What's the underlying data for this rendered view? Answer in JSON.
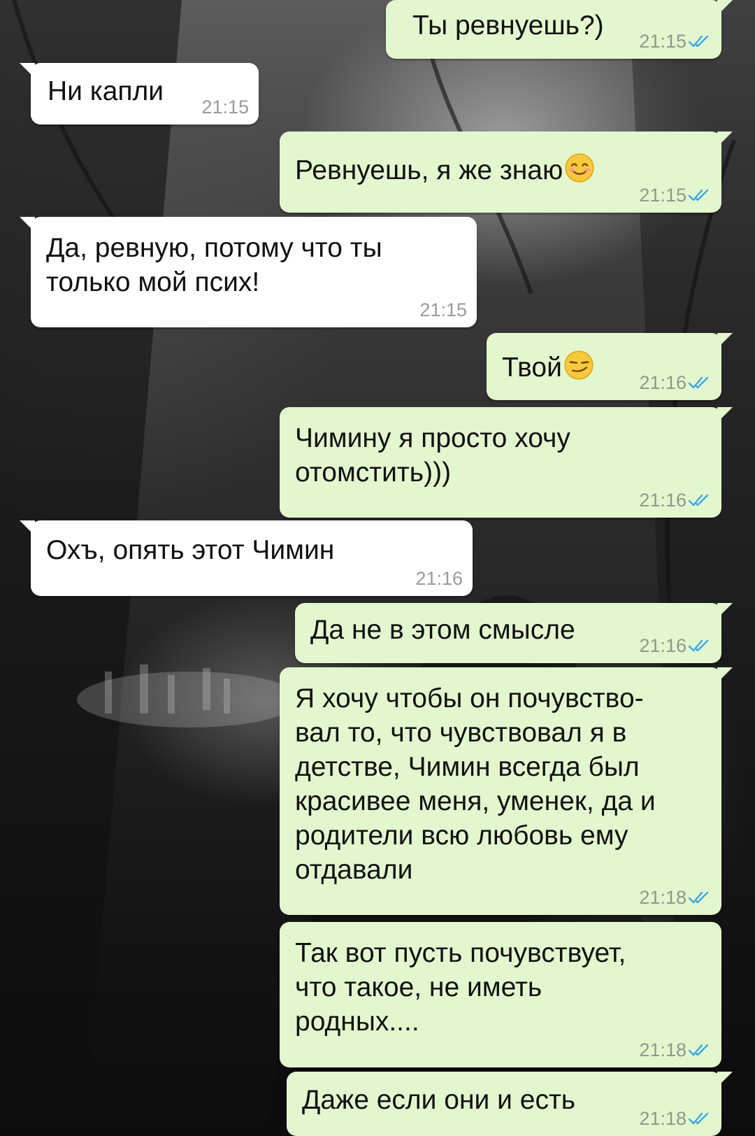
{
  "theme": {
    "outgoing_bubble": "#e3f7cf",
    "incoming_bubble": "#ffffff",
    "read_checks": "#3ba7e6"
  },
  "messages": [
    {
      "dir": "out",
      "text": "Ты ревнуешь?)",
      "time": "21:15",
      "status": "read"
    },
    {
      "dir": "in",
      "text": "Ни капли",
      "time": "21:15"
    },
    {
      "dir": "out",
      "text": "Ревнуешь, я же знаю",
      "emoji": "smiling-face-emoji",
      "time": "21:15",
      "status": "read"
    },
    {
      "dir": "in",
      "text": "Да, ревную, потому что ты\nтолько мой псих!",
      "time": "21:15"
    },
    {
      "dir": "out",
      "text": "Твой",
      "emoji": "smirking-face-emoji",
      "time": "21:16",
      "status": "read"
    },
    {
      "dir": "out",
      "text": "Чимину я просто хочу\nотомстить)))",
      "time": "21:16",
      "status": "read"
    },
    {
      "dir": "in",
      "text": "Охъ, опять этот Чимин",
      "time": "21:16"
    },
    {
      "dir": "out",
      "text": "Да не в этом смысле",
      "time": "21:16",
      "status": "read"
    },
    {
      "dir": "out",
      "text": "Я хочу чтобы он почувство-\nвал то, что чувствовал я в\nдетстве, Чимин всегда был\nкрасивее меня, уменек, да и\nродители всю любовь ему\nотдавали",
      "time": "21:18",
      "status": "read"
    },
    {
      "dir": "out",
      "text": "Так вот пусть почувствует,\nчто такое, не иметь\nродных....",
      "time": "21:18",
      "status": "read"
    },
    {
      "dir": "out",
      "text": "Даже если они и есть",
      "time": "21:18",
      "status": "read"
    }
  ]
}
